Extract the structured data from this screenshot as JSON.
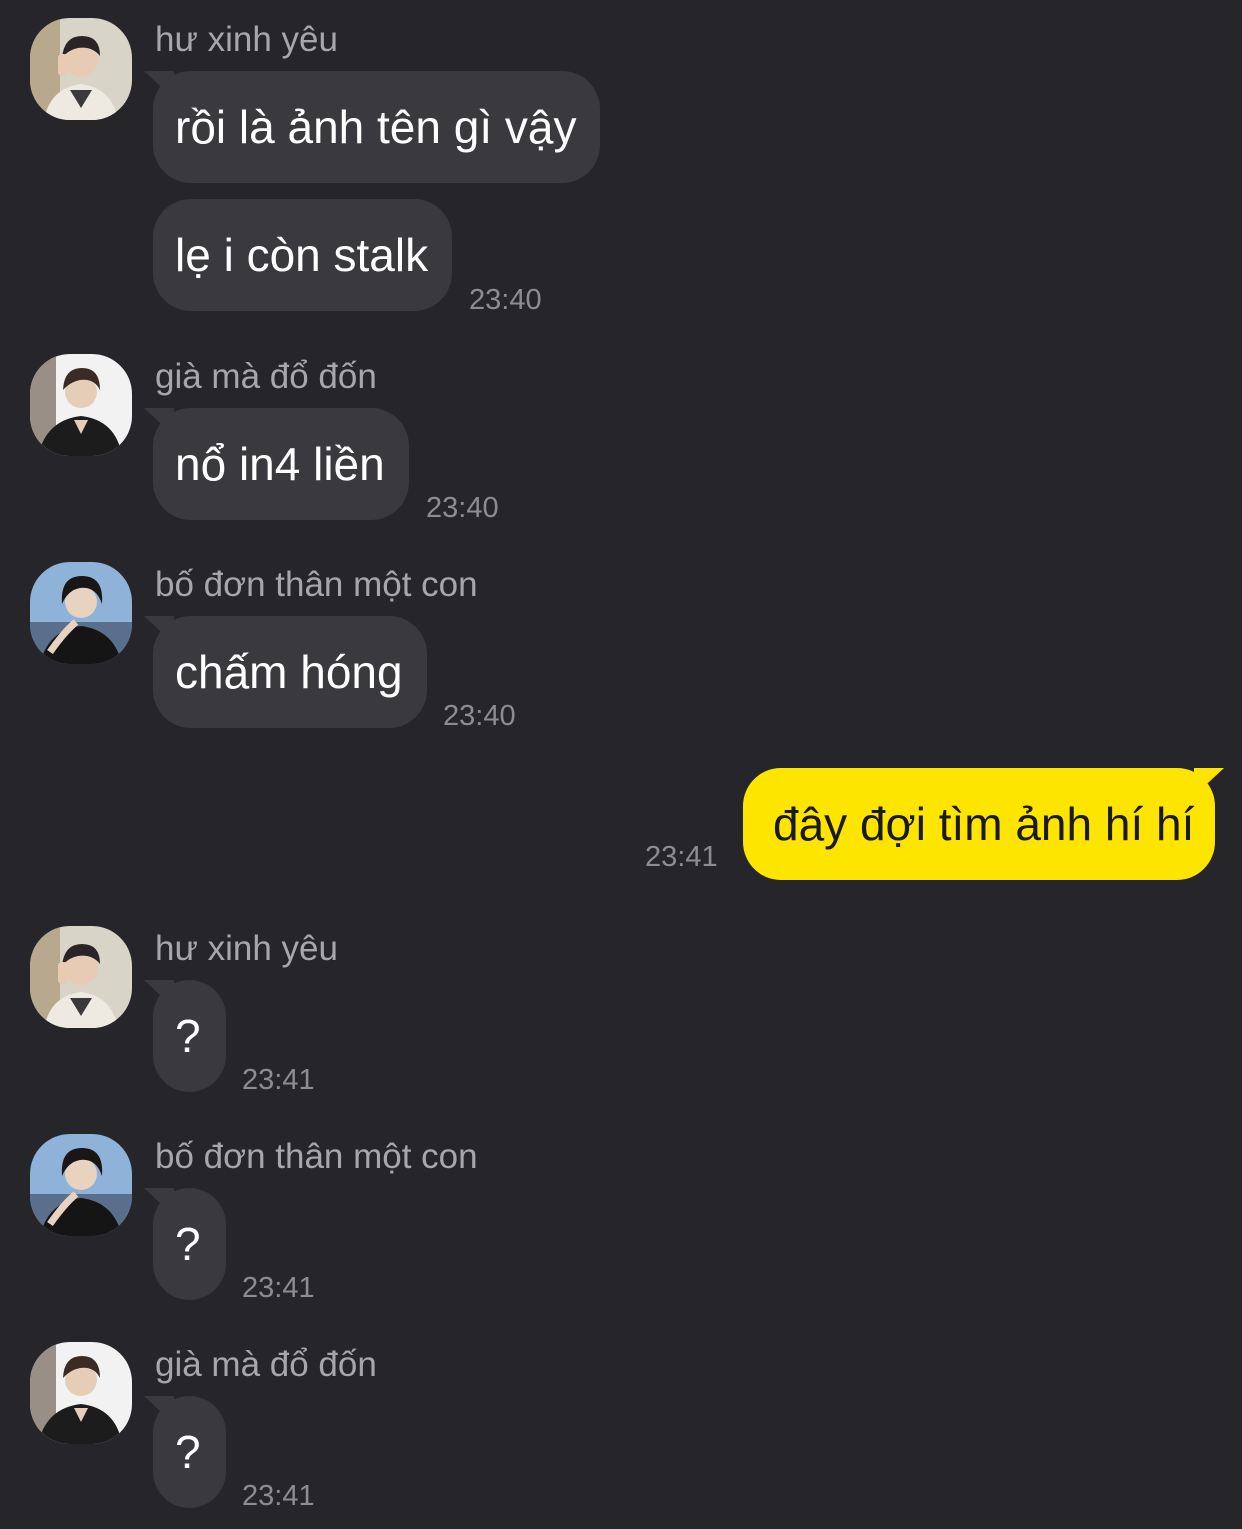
{
  "senders": {
    "hu": "hư xinh yêu",
    "gia": "già mà đổ đốn",
    "bo": "bố đơn thân một con"
  },
  "messages": [
    {
      "sender": "hư xinh yêu",
      "text": "rồi là ảnh tên gì vậy"
    },
    {
      "sender": "hư xinh yêu",
      "text": "lẹ i còn stalk",
      "time": "23:40"
    },
    {
      "sender": "già mà đổ đốn",
      "text": "nổ in4 liền",
      "time": "23:40"
    },
    {
      "sender": "bố đơn thân một con",
      "text": "chấm hóng",
      "time": "23:40"
    },
    {
      "sender": "me",
      "text": "đây đợi tìm ảnh hí hí",
      "time": "23:41"
    },
    {
      "sender": "hư xinh yêu",
      "text": "?",
      "time": "23:41"
    },
    {
      "sender": "bố đơn thân một con",
      "text": "?",
      "time": "23:41"
    },
    {
      "sender": "già mà đổ đốn",
      "text": "?",
      "time": "23:41"
    }
  ],
  "colors": {
    "background": "#26262a",
    "incoming_bubble": "#3a3a3e",
    "outgoing_bubble": "#fee500",
    "sender_text": "#a6a6ab",
    "time_text": "#8c8c92"
  }
}
